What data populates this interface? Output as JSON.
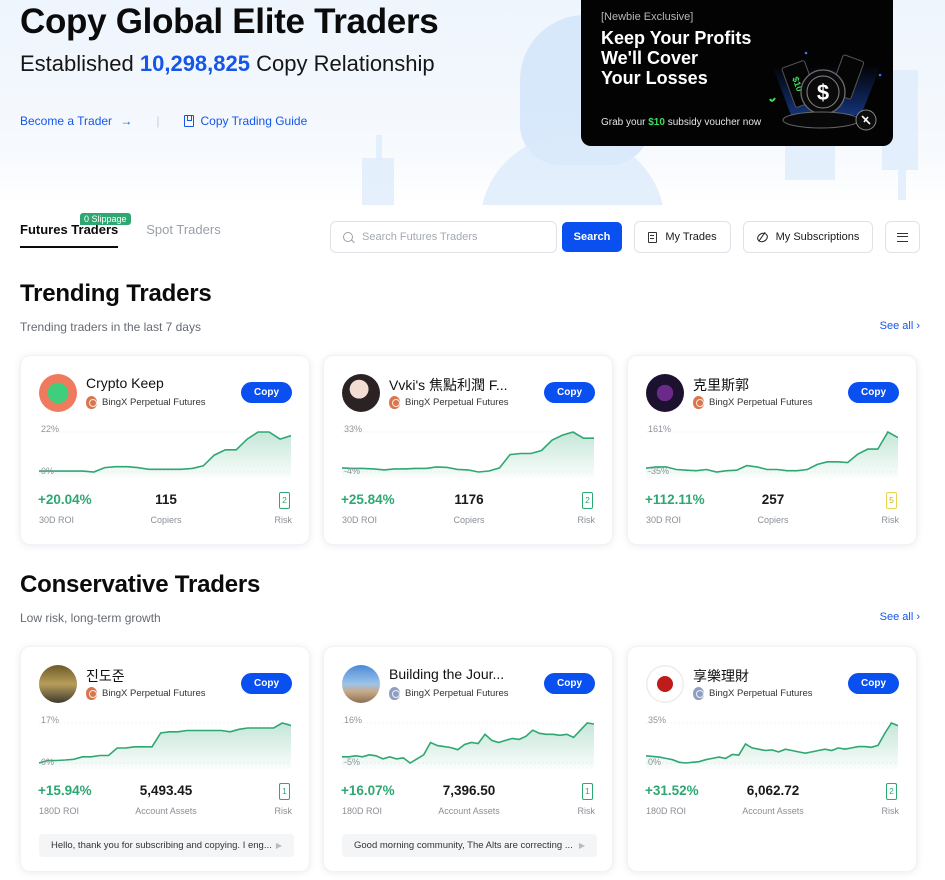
{
  "hero": {
    "title": "Copy Global Elite Traders",
    "subtitle_prefix": "Established",
    "relationship_count": "10,298,825",
    "subtitle_suffix": "Copy Relationship",
    "become_trader": "Become a Trader",
    "arrow": "→",
    "separator": "|",
    "guide": "Copy Trading Guide"
  },
  "banner": {
    "tag": "[Newbie Exclusive]",
    "headline_line1": "Keep Your Profits",
    "headline_line2": "We'll Cover",
    "headline_line3": "Your Losses",
    "cta_prefix": "Grab your",
    "cta_amount": "$10",
    "cta_suffix": "subsidy voucher now",
    "voucher_label": "$10",
    "coin_symbol": "$",
    "accent_color": "#3ede5a"
  },
  "tabs": {
    "items": [
      {
        "label": "Futures Traders",
        "active": true,
        "badge": "0 Slippage"
      },
      {
        "label": "Spot Traders",
        "active": false
      }
    ]
  },
  "toolbar": {
    "search_placeholder": "Search Futures Traders",
    "search_value": "",
    "search_label": "Search",
    "my_trades_label": "My Trades",
    "my_subscriptions_label": "My Subscriptions"
  },
  "sections": {
    "trending": {
      "title": "Trending Traders",
      "subtitle": "Trending traders in the last 7 days",
      "see_all": "See all",
      "see_all_chevron": "›"
    },
    "conservative": {
      "title": "Conservative Traders",
      "subtitle": "Low risk, long-term growth",
      "see_all": "See all",
      "see_all_chevron": "›"
    }
  },
  "trending_cards": [
    {
      "name": "Crypto Keep",
      "platform": "BingX Perpetual Futures",
      "medal": "bronze",
      "copy_label": "Copy",
      "y_max_label": "22%",
      "y_min_label": "0%",
      "roi": "+20.04%",
      "roi_label": "30D ROI",
      "stat_value": "115",
      "stat_label": "Copiers",
      "risk": "2",
      "risk_label": "Risk",
      "risk_level": "low",
      "series": [
        0,
        0,
        0,
        0,
        0,
        -0.5,
        2,
        2.5,
        2.5,
        2,
        1,
        1,
        1,
        1,
        1.5,
        3,
        9,
        12,
        12,
        18,
        22,
        22,
        18,
        20
      ]
    },
    {
      "name": "Vvki's 焦點利潤 F...",
      "platform": "BingX Perpetual Futures",
      "medal": "bronze",
      "copy_label": "Copy",
      "y_max_label": "33%",
      "y_min_label": "-4%",
      "roi": "+25.84%",
      "roi_label": "30D ROI",
      "stat_value": "1176",
      "stat_label": "Copiers",
      "risk": "2",
      "risk_label": "Risk",
      "risk_level": "low",
      "series": [
        -1,
        -1.5,
        -1.5,
        -2,
        -3,
        -2,
        -2,
        -1.5,
        -1.5,
        0,
        -0.5,
        -2.5,
        -3,
        -5,
        -4,
        -1,
        12,
        13,
        13,
        16,
        26,
        31,
        34,
        28,
        28
      ]
    },
    {
      "name": "克里斯郭",
      "platform": "BingX Perpetual Futures",
      "medal": "bronze",
      "copy_label": "Copy",
      "y_max_label": "161%",
      "y_min_label": "-35%",
      "roi": "+112.11%",
      "roi_label": "30D ROI",
      "stat_value": "257",
      "stat_label": "Copiers",
      "risk": "5",
      "risk_label": "Risk",
      "risk_level": "medium",
      "series": [
        -30,
        -25,
        -25,
        -35,
        -38,
        -40,
        -35,
        -45,
        -40,
        -38,
        -20,
        -25,
        -35,
        -35,
        -40,
        -40,
        -35,
        -15,
        -5,
        -5,
        -8,
        25,
        45,
        45,
        112,
        90
      ]
    }
  ],
  "conservative_cards": [
    {
      "name": "진도준",
      "platform": "BingX Perpetual Futures",
      "medal": "bronze",
      "copy_label": "Copy",
      "y_max_label": "17%",
      "y_min_label": "0%",
      "roi": "+15.94%",
      "roi_label": "180D ROI",
      "stat_value": "5,493.45",
      "stat_label": "Account Assets",
      "risk": "1",
      "risk_label": "Risk",
      "risk_level": "low",
      "note": "Hello, thank you for subscribing and copying. I eng...",
      "series": [
        0,
        1,
        1,
        1.2,
        1.5,
        2.5,
        2.5,
        3,
        3,
        6,
        6,
        6.5,
        6.5,
        6.5,
        12,
        12.5,
        12.5,
        13,
        13,
        13,
        13,
        13,
        12.5,
        13.5,
        14,
        14,
        14,
        14,
        16,
        15
      ]
    },
    {
      "name": "Building the Jour...",
      "platform": "BingX Perpetual Futures",
      "medal": "silver",
      "copy_label": "Copy",
      "y_max_label": "16%",
      "y_min_label": "-5%",
      "roi": "+16.07%",
      "roi_label": "180D ROI",
      "stat_value": "7,396.50",
      "stat_label": "Account Assets",
      "risk": "1",
      "risk_label": "Risk",
      "risk_level": "low",
      "note": "Good morning community, The Alts are correcting ...",
      "series": [
        -2,
        -2,
        -1.5,
        -2,
        -1,
        -1.5,
        -3,
        -2,
        -3,
        -2.5,
        -5,
        -3,
        -1,
        5,
        3.5,
        3,
        2.5,
        1.5,
        4,
        5,
        4.5,
        9,
        6,
        5,
        6,
        7,
        6.5,
        8,
        11,
        9.5,
        9,
        9,
        8.5,
        9,
        7.5,
        11,
        14.5,
        14
      ]
    },
    {
      "name": "享樂理財",
      "platform": "BingX Perpetual Futures",
      "medal": "silver",
      "copy_label": "Copy",
      "y_max_label": "35%",
      "y_min_label": "0%",
      "roi": "+31.52%",
      "roi_label": "180D ROI",
      "stat_value": "6,062.72",
      "stat_label": "Account Assets",
      "risk": "2",
      "risk_label": "Risk",
      "risk_level": "low",
      "note": "",
      "series": [
        5,
        4.5,
        4,
        3,
        2,
        0,
        -0.5,
        0,
        0.5,
        2,
        3,
        4,
        3,
        6,
        5.5,
        14,
        11,
        10,
        9,
        9.5,
        8,
        10,
        9,
        8,
        7,
        8,
        9,
        10,
        9,
        11,
        10,
        11,
        12,
        12,
        11.5,
        13,
        22,
        30,
        28
      ]
    }
  ]
}
